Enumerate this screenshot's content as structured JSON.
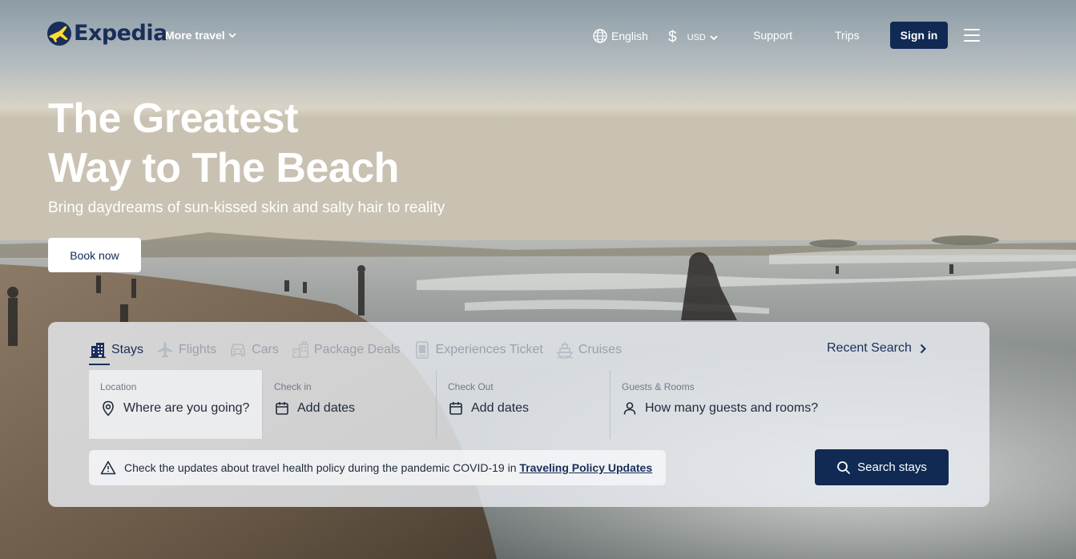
{
  "brand": {
    "name": "Expedia"
  },
  "header": {
    "more_travel": "More travel",
    "language": "English",
    "currency_symbol": "$",
    "currency_code": "USD",
    "support": "Support",
    "trips": "Trips",
    "sign_in": "Sign in"
  },
  "hero": {
    "title_line1": "The Greatest",
    "title_line2": "Way to The Beach",
    "subtitle": "Bring daydreams of sun-kissed skin and salty hair to reality",
    "cta": "Book now"
  },
  "search": {
    "tabs": [
      {
        "label": "Stays",
        "icon": "hotel-icon",
        "active": true
      },
      {
        "label": "Flights",
        "icon": "plane-icon",
        "active": false
      },
      {
        "label": "Cars",
        "icon": "car-icon",
        "active": false
      },
      {
        "label": "Package Deals",
        "icon": "package-icon",
        "active": false
      },
      {
        "label": "Experiences Ticket",
        "icon": "ticket-icon",
        "active": false
      },
      {
        "label": "Cruises",
        "icon": "ship-icon",
        "active": false
      }
    ],
    "recent_search": "Recent Search",
    "fields": {
      "location": {
        "label": "Location",
        "placeholder": "Where are you going?"
      },
      "check_in": {
        "label": "Check in",
        "placeholder": "Add dates"
      },
      "check_out": {
        "label": "Check Out",
        "placeholder": "Add dates"
      },
      "guests": {
        "label": "Guests & Rooms",
        "placeholder": "How many guests and rooms?"
      }
    },
    "notice_text": "Check the updates about travel health policy during the pandemic COVID-19 in",
    "notice_link": "Traveling Policy Updates",
    "search_button": "Search stays"
  },
  "colors": {
    "primary": "#102a54",
    "text_dark": "#1a2e5a",
    "tab_inactive": "#9aa1ab"
  }
}
